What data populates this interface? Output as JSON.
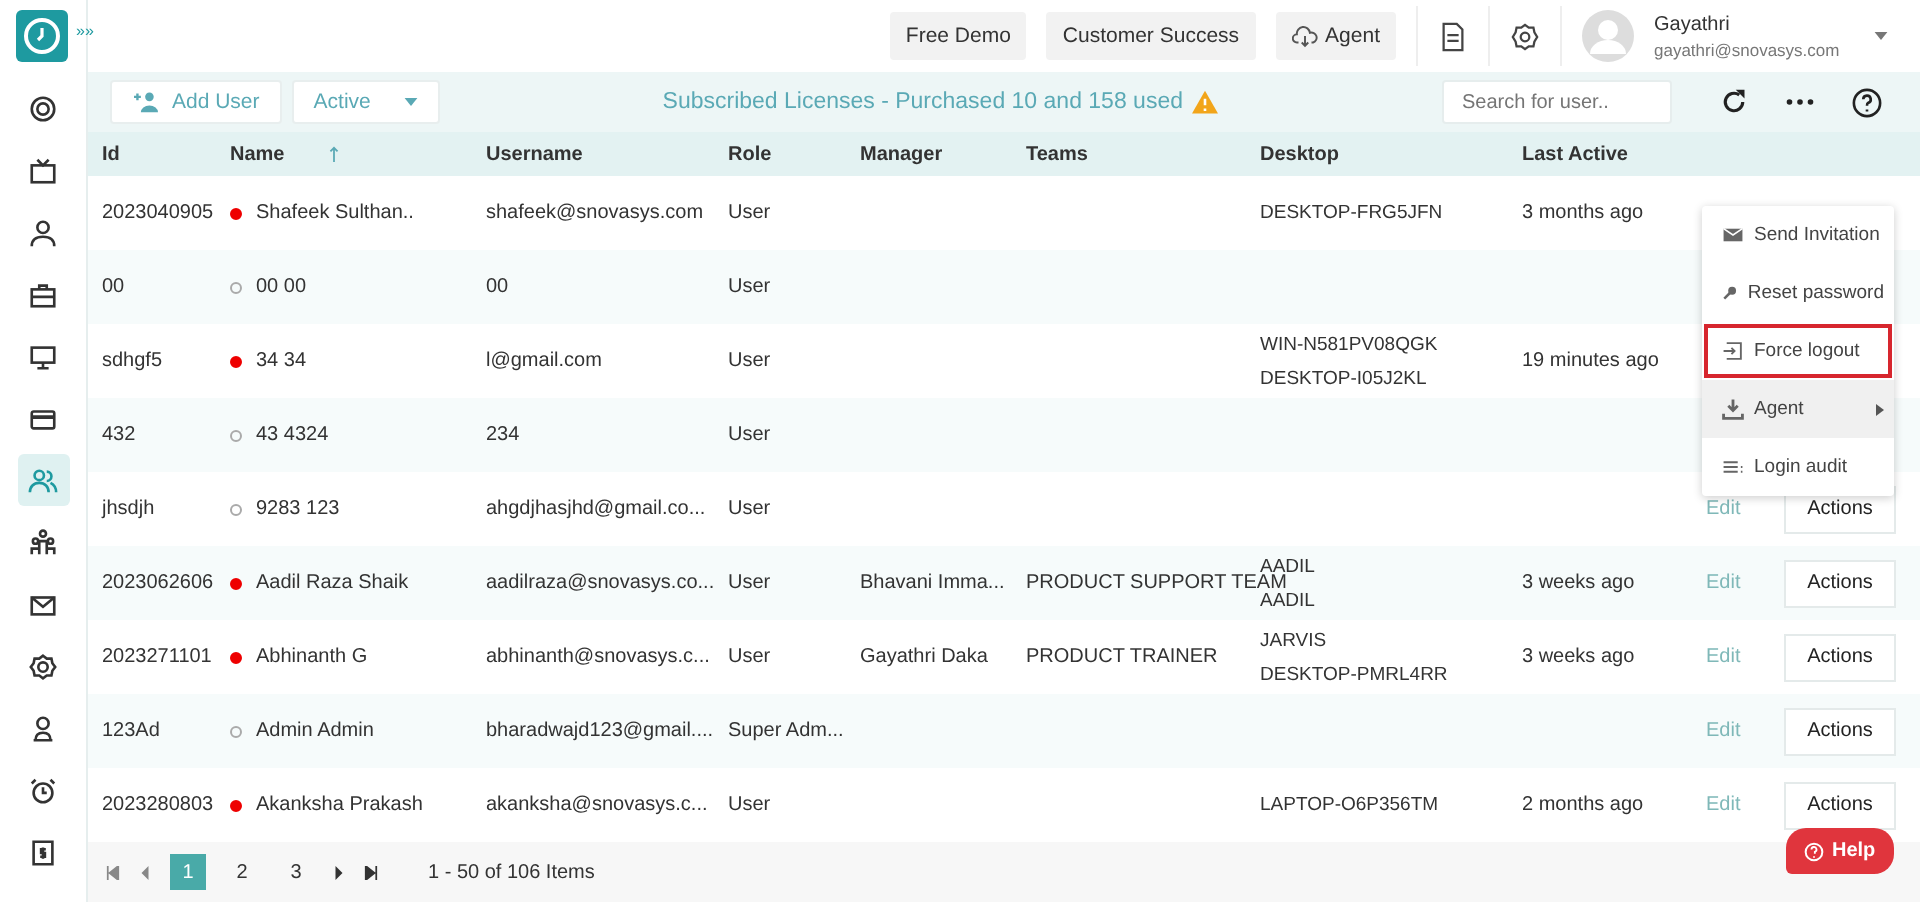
{
  "sidebar": {
    "expand": "»»",
    "items": [
      {
        "selected": false
      },
      {
        "selected": false
      },
      {
        "selected": false
      },
      {
        "selected": false
      },
      {
        "selected": false
      },
      {
        "selected": false
      },
      {
        "selected": true
      },
      {
        "selected": false
      },
      {
        "selected": false
      },
      {
        "selected": false
      },
      {
        "selected": false
      },
      {
        "selected": false
      },
      {
        "selected": false
      }
    ]
  },
  "topbar": {
    "buttons": [
      "Free Demo",
      "Customer Success",
      "Agent"
    ],
    "user": {
      "name": "Gayathri",
      "email": "gayathri@snovasys.com"
    }
  },
  "toolbar": {
    "add_user": "Add User",
    "filter": "Active",
    "license": "Subscribed Licenses - Purchased 10 and 158 used",
    "search": {
      "placeholder": "Search for user.."
    }
  },
  "table": {
    "columns": [
      {
        "label": "Id",
        "sorted": false
      },
      {
        "label": "Name",
        "sorted": true
      },
      {
        "label": "Username",
        "sorted": false
      },
      {
        "label": "Role",
        "sorted": false
      },
      {
        "label": "Manager",
        "sorted": false
      },
      {
        "label": "Teams",
        "sorted": false
      },
      {
        "label": "Desktop",
        "sorted": false
      },
      {
        "label": "Last Active",
        "sorted": false
      }
    ],
    "rows": [
      {
        "id": "2023040905",
        "name": "Shafeek Sulthan..",
        "online": true,
        "username": "shafeek@snovasys.com",
        "role": "User",
        "desktop": [
          "DESKTOP-FRG5JFN"
        ],
        "last_active": "3 months ago"
      },
      {
        "id": "00",
        "name": "00 00",
        "online": false,
        "username": "00",
        "role": "User",
        "desktop": []
      },
      {
        "id": "sdhgf5",
        "name": "34 34",
        "online": true,
        "username": "l@gmail.com",
        "role": "User",
        "desktop": [
          "WIN-N581PV08QGK",
          "DESKTOP-I05J2KL"
        ],
        "last_active": "19 minutes ago"
      },
      {
        "id": "432",
        "name": "43 4324",
        "online": false,
        "username": "234",
        "role": "User",
        "desktop": []
      },
      {
        "id": "jhsdjh",
        "name": "9283 123",
        "online": false,
        "username": "ahgdjhasjhd@gmail.co...",
        "role": "User",
        "desktop": [],
        "edit": "Edit",
        "actions": "Actions"
      },
      {
        "id": "2023062606",
        "name": "Aadil Raza Shaik",
        "online": true,
        "username": "aadilraza@snovasys.co...",
        "role": "User",
        "manager": "Bhavani Imma...",
        "teams": "PRODUCT SUPPORT TEAM",
        "desktop": [
          "AADIL",
          "AADIL"
        ],
        "last_active": "3 weeks ago",
        "edit": "Edit",
        "actions": "Actions"
      },
      {
        "id": "2023271101",
        "name": "Abhinanth G",
        "online": true,
        "username": "abhinanth@snovasys.c...",
        "role": "User",
        "manager": "Gayathri Daka",
        "teams": "PRODUCT TRAINER",
        "desktop": [
          "JARVIS",
          "DESKTOP-PMRL4RR"
        ],
        "last_active": "3 weeks ago",
        "edit": "Edit",
        "actions": "Actions"
      },
      {
        "id": "123Ad",
        "name": "Admin Admin",
        "online": false,
        "username": "bharadwajd123@gmail....",
        "role": "Super Adm...",
        "desktop": [],
        "edit": "Edit",
        "actions": "Actions"
      },
      {
        "id": "2023280803",
        "name": "Akanksha Prakash",
        "online": true,
        "username": "akanksha@snovasys.c...",
        "role": "User",
        "desktop": [
          "LAPTOP-O6P356TM"
        ],
        "last_active": "2 months ago",
        "edit": "Edit",
        "actions": "Actions"
      }
    ]
  },
  "pagination": {
    "pages": [
      {
        "label": "1",
        "selected": true
      },
      {
        "label": "2",
        "selected": false
      },
      {
        "label": "3",
        "selected": false
      }
    ],
    "summary": "1 - 50 of 106 Items"
  },
  "menu": [
    {
      "label": "Send Invitation",
      "outlined": false,
      "hovered": false,
      "submenu": false
    },
    {
      "label": "Reset password",
      "outlined": false,
      "hovered": false,
      "submenu": false
    },
    {
      "label": "Force logout",
      "outlined": true,
      "hovered": false,
      "submenu": false
    },
    {
      "label": "Agent",
      "outlined": false,
      "hovered": true,
      "submenu": true
    },
    {
      "label": "Login audit",
      "outlined": false,
      "hovered": false,
      "submenu": false
    }
  ],
  "help": "Help"
}
